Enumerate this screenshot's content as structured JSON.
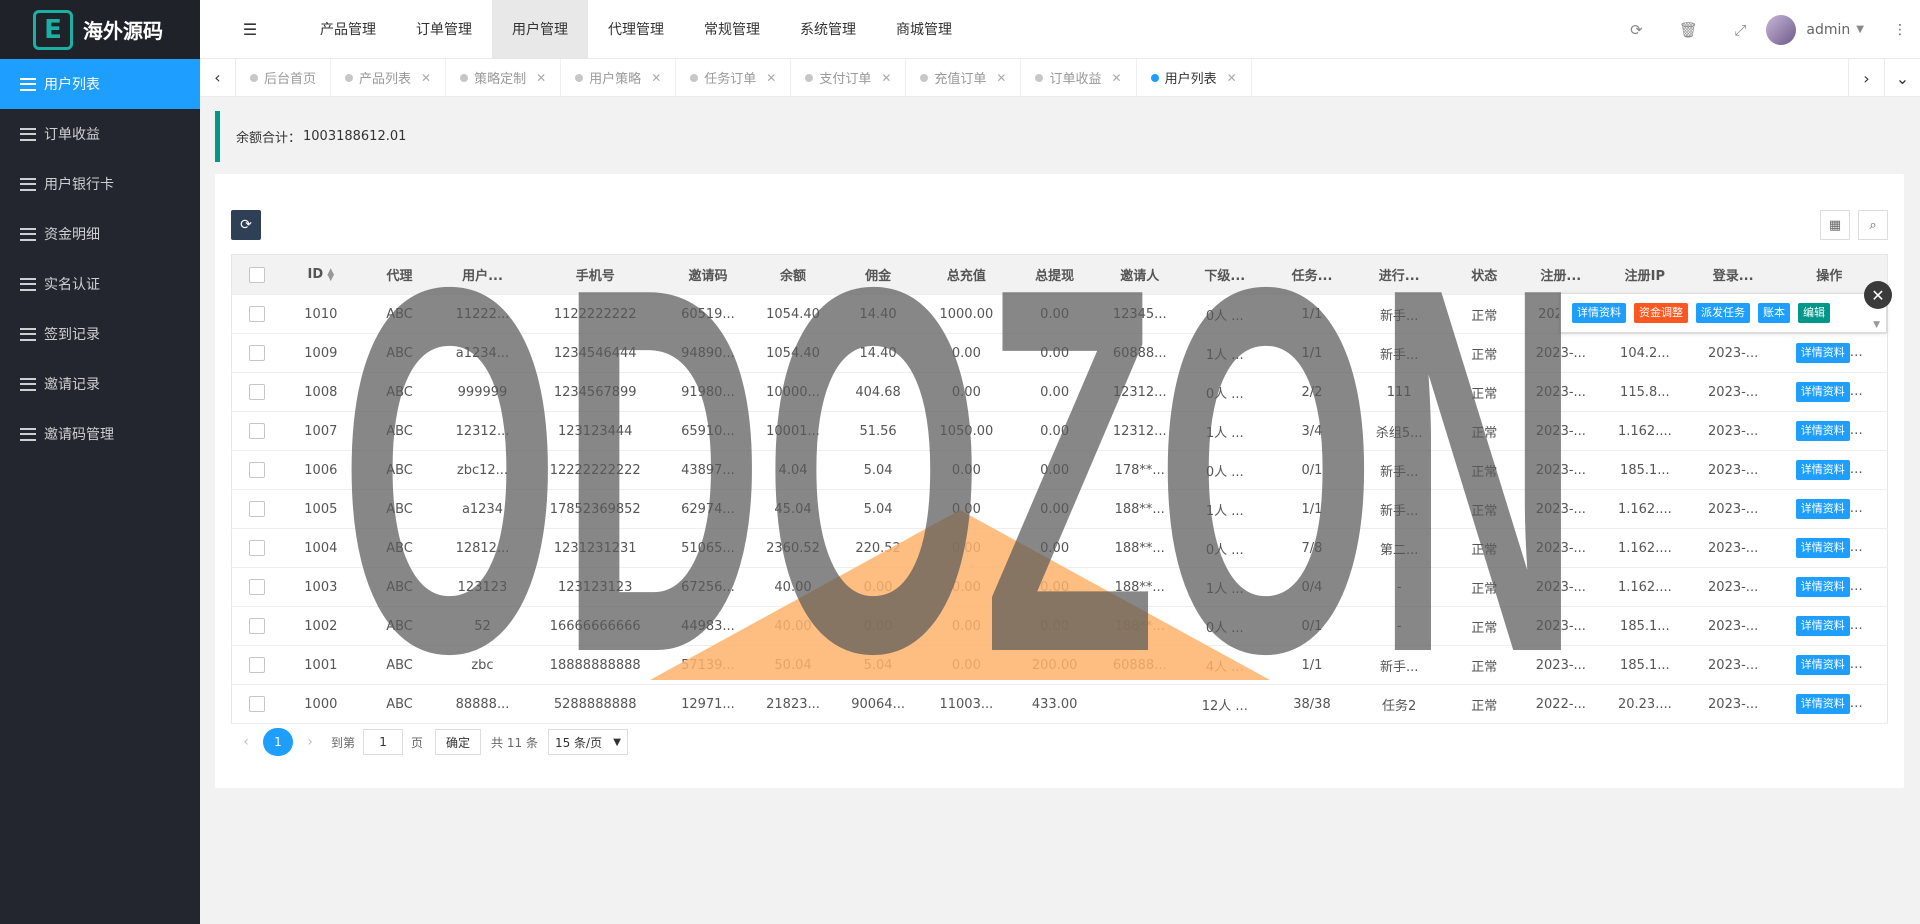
{
  "brand": {
    "logo_letter": "E",
    "name": "海外源码"
  },
  "sidebar": {
    "items": [
      {
        "label": "用户列表",
        "active": true
      },
      {
        "label": "订单收益"
      },
      {
        "label": "用户银行卡"
      },
      {
        "label": "资金明细"
      },
      {
        "label": "实名认证"
      },
      {
        "label": "签到记录"
      },
      {
        "label": "邀请记录"
      },
      {
        "label": "邀请码管理"
      }
    ]
  },
  "header": {
    "tabs": [
      "产品管理",
      "订单管理",
      "用户管理",
      "代理管理",
      "常规管理",
      "系统管理",
      "商城管理"
    ],
    "active_tab": 2,
    "user": "admin"
  },
  "pagetabs": [
    {
      "label": "后台首页",
      "closable": false
    },
    {
      "label": "产品列表",
      "closable": true
    },
    {
      "label": "策略定制",
      "closable": true
    },
    {
      "label": "用户策略",
      "closable": true
    },
    {
      "label": "任务订单",
      "closable": true
    },
    {
      "label": "支付订单",
      "closable": true
    },
    {
      "label": "充值订单",
      "closable": true
    },
    {
      "label": "订单收益",
      "closable": true
    },
    {
      "label": "用户列表",
      "closable": true,
      "active": true
    }
  ],
  "notice": {
    "label": "余额合计：",
    "value": "1003188612.01"
  },
  "table": {
    "columns": [
      "ID",
      "代理",
      "用户...",
      "手机号",
      "邀请码",
      "余额",
      "佣金",
      "总充值",
      "总提现",
      "邀请人",
      "下级...",
      "任务...",
      "进行...",
      "状态",
      "注册...",
      "注册IP",
      "登录...",
      "操作"
    ],
    "rows": [
      [
        "1010",
        "ABC",
        "11222...",
        "1122222222",
        "60519...",
        "1054.40",
        "14.40",
        "1000.00",
        "0.00",
        "12345...",
        "0人 ...",
        "1/1",
        "新手...",
        "正常",
        "2023...",
        "",
        "",
        ""
      ],
      [
        "1009",
        "ABC",
        "a1234...",
        "1234546444",
        "94890...",
        "1054.40",
        "14.40",
        "0.00",
        "0.00",
        "60888...",
        "1人 ...",
        "1/1",
        "新手...",
        "正常",
        "2023-...",
        "104.2...",
        "2023-...",
        "详情资料"
      ],
      [
        "1008",
        "ABC",
        "999999",
        "1234567899",
        "91980...",
        "10000...",
        "404.68",
        "0.00",
        "0.00",
        "12312...",
        "0人 ...",
        "2/2",
        "111",
        "正常",
        "2023-...",
        "115.8...",
        "2023-...",
        "详情资料"
      ],
      [
        "1007",
        "ABC",
        "12312...",
        "123123444",
        "65910...",
        "10001...",
        "51.56",
        "1050.00",
        "0.00",
        "12312...",
        "1人 ...",
        "3/4",
        "杀组5...",
        "正常",
        "2023-...",
        "1.162....",
        "2023-...",
        "详情资料"
      ],
      [
        "1006",
        "ABC",
        "zbc12...",
        "12222222222",
        "43897...",
        "4.04",
        "5.04",
        "0.00",
        "0.00",
        "178**...",
        "0人 ...",
        "0/1",
        "新手...",
        "正常",
        "2023-...",
        "185.1...",
        "2023-...",
        "详情资料"
      ],
      [
        "1005",
        "ABC",
        "a1234",
        "17852369852",
        "62974...",
        "45.04",
        "5.04",
        "0.00",
        "0.00",
        "188**...",
        "1人 ...",
        "1/1",
        "新手...",
        "正常",
        "2023-...",
        "1.162....",
        "2023-...",
        "详情资料"
      ],
      [
        "1004",
        "ABC",
        "12812...",
        "1231231231",
        "51065...",
        "2360.52",
        "220.52",
        "0.00",
        "0.00",
        "188**...",
        "0人 ...",
        "7/8",
        "第二...",
        "正常",
        "2023-...",
        "1.162....",
        "2023-...",
        "详情资料"
      ],
      [
        "1003",
        "ABC",
        "123123",
        "123123123",
        "67256...",
        "40.00",
        "0.00",
        "0.00",
        "0.00",
        "188**...",
        "1人 ...",
        "0/4",
        "-",
        "正常",
        "2023-...",
        "1.162....",
        "2023-...",
        "详情资料"
      ],
      [
        "1002",
        "ABC",
        "52",
        "16666666666",
        "44983...",
        "40.00",
        "0.00",
        "0.00",
        "0.00",
        "188**...",
        "0人 ...",
        "0/1",
        "-",
        "正常",
        "2023-...",
        "185.1...",
        "2023-...",
        "详情资料"
      ],
      [
        "1001",
        "ABC",
        "zbc",
        "18888888888",
        "57139...",
        "50.04",
        "5.04",
        "0.00",
        "200.00",
        "60888...",
        "4人 ...",
        "1/1",
        "新手...",
        "正常",
        "2023-...",
        "185.1...",
        "2023-...",
        "详情资料"
      ],
      [
        "1000",
        "ABC",
        "88888...",
        "5288888888",
        "12971...",
        "21823...",
        "90064...",
        "11003...",
        "433.00",
        "",
        "12人 ...",
        "38/38",
        "任务2",
        "正常",
        "2022-...",
        "20.23....",
        "2023-...",
        "详情资料"
      ]
    ]
  },
  "fixed_ops": {
    "buttons": [
      {
        "label": "详情资料",
        "color": "#1e9fff"
      },
      {
        "label": "资金调整",
        "color": "#ff5722"
      },
      {
        "label": "派发任务",
        "color": "#1e9fff"
      },
      {
        "label": "账本",
        "color": "#1e9fff"
      },
      {
        "label": "编辑",
        "color": "#009688"
      }
    ]
  },
  "pager": {
    "current": "1",
    "goto_label": "到第",
    "goto_value": "1",
    "page_unit": "页",
    "confirm": "确定",
    "total": "共 11 条",
    "page_size": "15 条/页"
  },
  "watermark": {
    "text": "ODOZON"
  },
  "colors": {
    "sidebar": "#23262e",
    "accent": "#1e9fff",
    "teal": "#009688",
    "orange": "#ff5722",
    "watermark_orange": "#ffb36b"
  }
}
